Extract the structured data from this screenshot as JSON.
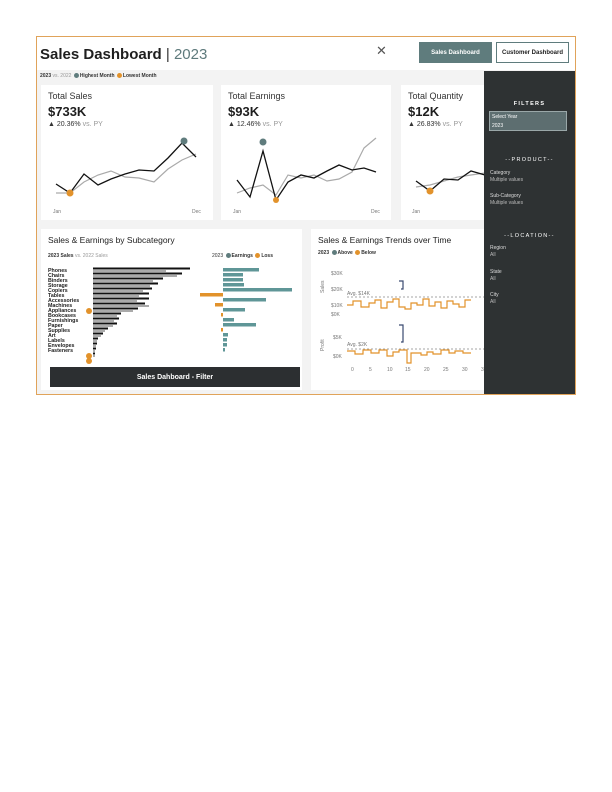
{
  "header": {
    "title": "Sales Dashboard",
    "separator": "|",
    "year": "2023",
    "close_glyph": "✕",
    "buttons": {
      "sales": "Sales Dashboard",
      "customer": "Customer Dashboard"
    }
  },
  "top_legend": {
    "current": "2023",
    "vs": "vs. 2022",
    "highest": "Highest Month",
    "lowest": "Lowest Month"
  },
  "colors": {
    "accent": "#5f7c7d",
    "highlight": "#e2922b",
    "panel": "#2e3233",
    "loss": "#e2922b",
    "prior": "#aaaaaa"
  },
  "kpis": [
    {
      "label": "Total Sales",
      "value": "$733K",
      "arrow": "▲",
      "delta": "20.36%",
      "vs": "vs. PY",
      "start": "Jan",
      "end": "Dec"
    },
    {
      "label": "Total Earnings",
      "value": "$93K",
      "arrow": "▲",
      "delta": "12.46%",
      "vs": "vs. PY",
      "start": "Jan",
      "end": "Dec"
    },
    {
      "label": "Total Quantity",
      "value": "$12K",
      "arrow": "▲",
      "delta": "26.83%",
      "vs": "vs. PY",
      "start": "Jan",
      "end": ""
    }
  ],
  "subcategory": {
    "title": "Sales & Earnings by Subcategory",
    "legend_sales": {
      "year": "2023",
      "label": "Sales",
      "vs": "vs. 2022 Sales"
    },
    "legend_earn": {
      "year": "2023",
      "earnings": "Earnings",
      "loss": "Loss"
    },
    "filter_label": "Sales Dahboard - Filter",
    "items": [
      "Phones",
      "Chairs",
      "Binders",
      "Storage",
      "Copiers",
      "Tables",
      "Accessories",
      "Machines",
      "Appliances",
      "Bookcases",
      "Furnishings",
      "Paper",
      "Supplies",
      "Art",
      "Labels",
      "Envelopes",
      "Fasteners"
    ]
  },
  "trends": {
    "title": "Sales & Earnings Trends over Time",
    "legend": {
      "year": "2023",
      "above": "Above",
      "below": "Below"
    },
    "sales_axis": "Sales",
    "profit_axis": "Profit",
    "sales_ticks": [
      "$30K",
      "$20K",
      "$10K",
      "$0K"
    ],
    "profit_ticks": [
      "$5K",
      "$0K"
    ],
    "sales_avg": "Avg. $14K",
    "profit_avg": "Avg. $2K",
    "x_ticks": [
      "0",
      "5",
      "10",
      "15",
      "20",
      "25",
      "30",
      "35",
      "40",
      "45",
      "50",
      "55"
    ]
  },
  "filters": {
    "heading": "FILTERS",
    "year_label": "Select Year",
    "year_value": "2023",
    "product_heading": "--PRODUCT--",
    "category_label": "Category",
    "category_value": "Multiple values",
    "subcat_label": "Sub-Category",
    "subcat_value": "Multiple values",
    "location_heading": "--LOCATION--",
    "region_label": "Region",
    "region_value": "All",
    "state_label": "State",
    "state_value": "All",
    "city_label": "City",
    "city_value": "All"
  }
}
